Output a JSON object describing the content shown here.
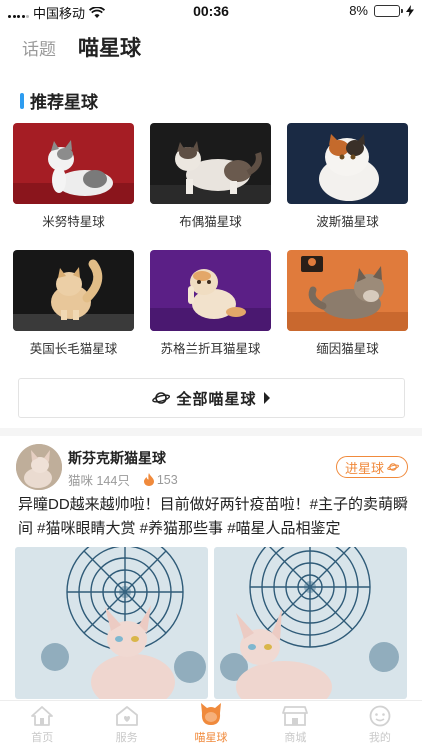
{
  "status_bar": {
    "carrier": "中国移动",
    "time": "00:36",
    "battery_percent": "8%",
    "battery_level": 0.08
  },
  "header": {
    "tab_topic": "话题",
    "tab_planet": "喵星球"
  },
  "recommend": {
    "title": "推荐星球",
    "items": [
      {
        "label": "米努特星球"
      },
      {
        "label": "布偶猫星球"
      },
      {
        "label": "波斯猫星球"
      },
      {
        "label": "英国长毛猫星球"
      },
      {
        "label": "苏格兰折耳猫星球"
      },
      {
        "label": "缅因猫星球"
      }
    ]
  },
  "all_button": {
    "label": "全部喵星球"
  },
  "post": {
    "planet_name": "斯芬克斯猫星球",
    "members": "猫咪 144只",
    "hot_count": "153",
    "join_label": "进星球",
    "text": "异瞳DD越来越帅啦！目前做好两针疫苗啦！#主子的卖萌瞬间 #猫咪眼睛大赏 #养猫那些事 #喵星人品相鉴定"
  },
  "bottom_nav": {
    "items": [
      {
        "label": "首页"
      },
      {
        "label": "服务"
      },
      {
        "label": "喵星球"
      },
      {
        "label": "商城"
      },
      {
        "label": "我的"
      }
    ]
  },
  "colors": {
    "accent": "#f08a3c",
    "section_bar": "#2d9cf0",
    "battery_low": "#e23b3b"
  }
}
